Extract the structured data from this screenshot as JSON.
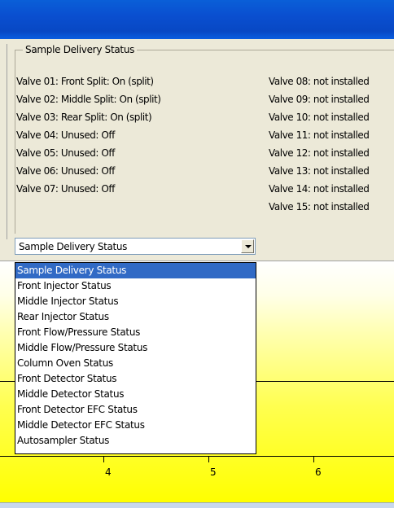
{
  "group": {
    "title": "Sample Delivery Status"
  },
  "valves_left": [
    "Valve 01: Front Split: On (split)",
    "Valve 02: Middle Split: On (split)",
    "Valve 03: Rear Split: On (split)",
    "Valve 04: Unused: Off",
    "Valve 05: Unused: Off",
    "Valve 06: Unused: Off",
    "Valve 07: Unused: Off"
  ],
  "valves_right": [
    "Valve 08: not installed",
    "Valve 09: not installed",
    "Valve 10: not installed",
    "Valve 11: not installed",
    "Valve 12: not installed",
    "Valve 13: not installed",
    "Valve 14: not installed",
    "Valve 15: not installed"
  ],
  "status_select": {
    "value": "Sample Delivery Status"
  },
  "dropdown_options": [
    "Sample Delivery Status",
    "Front Injector Status",
    "Middle Injector Status",
    "Rear Injector Status",
    "Front Flow/Pressure Status",
    "Middle Flow/Pressure Status",
    "Column Oven Status",
    "Front Detector Status",
    "Middle Detector Status",
    "Front Detector EFC Status",
    "Middle Detector EFC Status",
    "Autosampler Status"
  ],
  "selected_index": 0,
  "axis_ticks": [
    "4",
    "5",
    "6"
  ],
  "colors": {
    "title_bar": "#0a4fd0",
    "selection": "#316ac5",
    "chart_yellow": "#ffff00"
  }
}
